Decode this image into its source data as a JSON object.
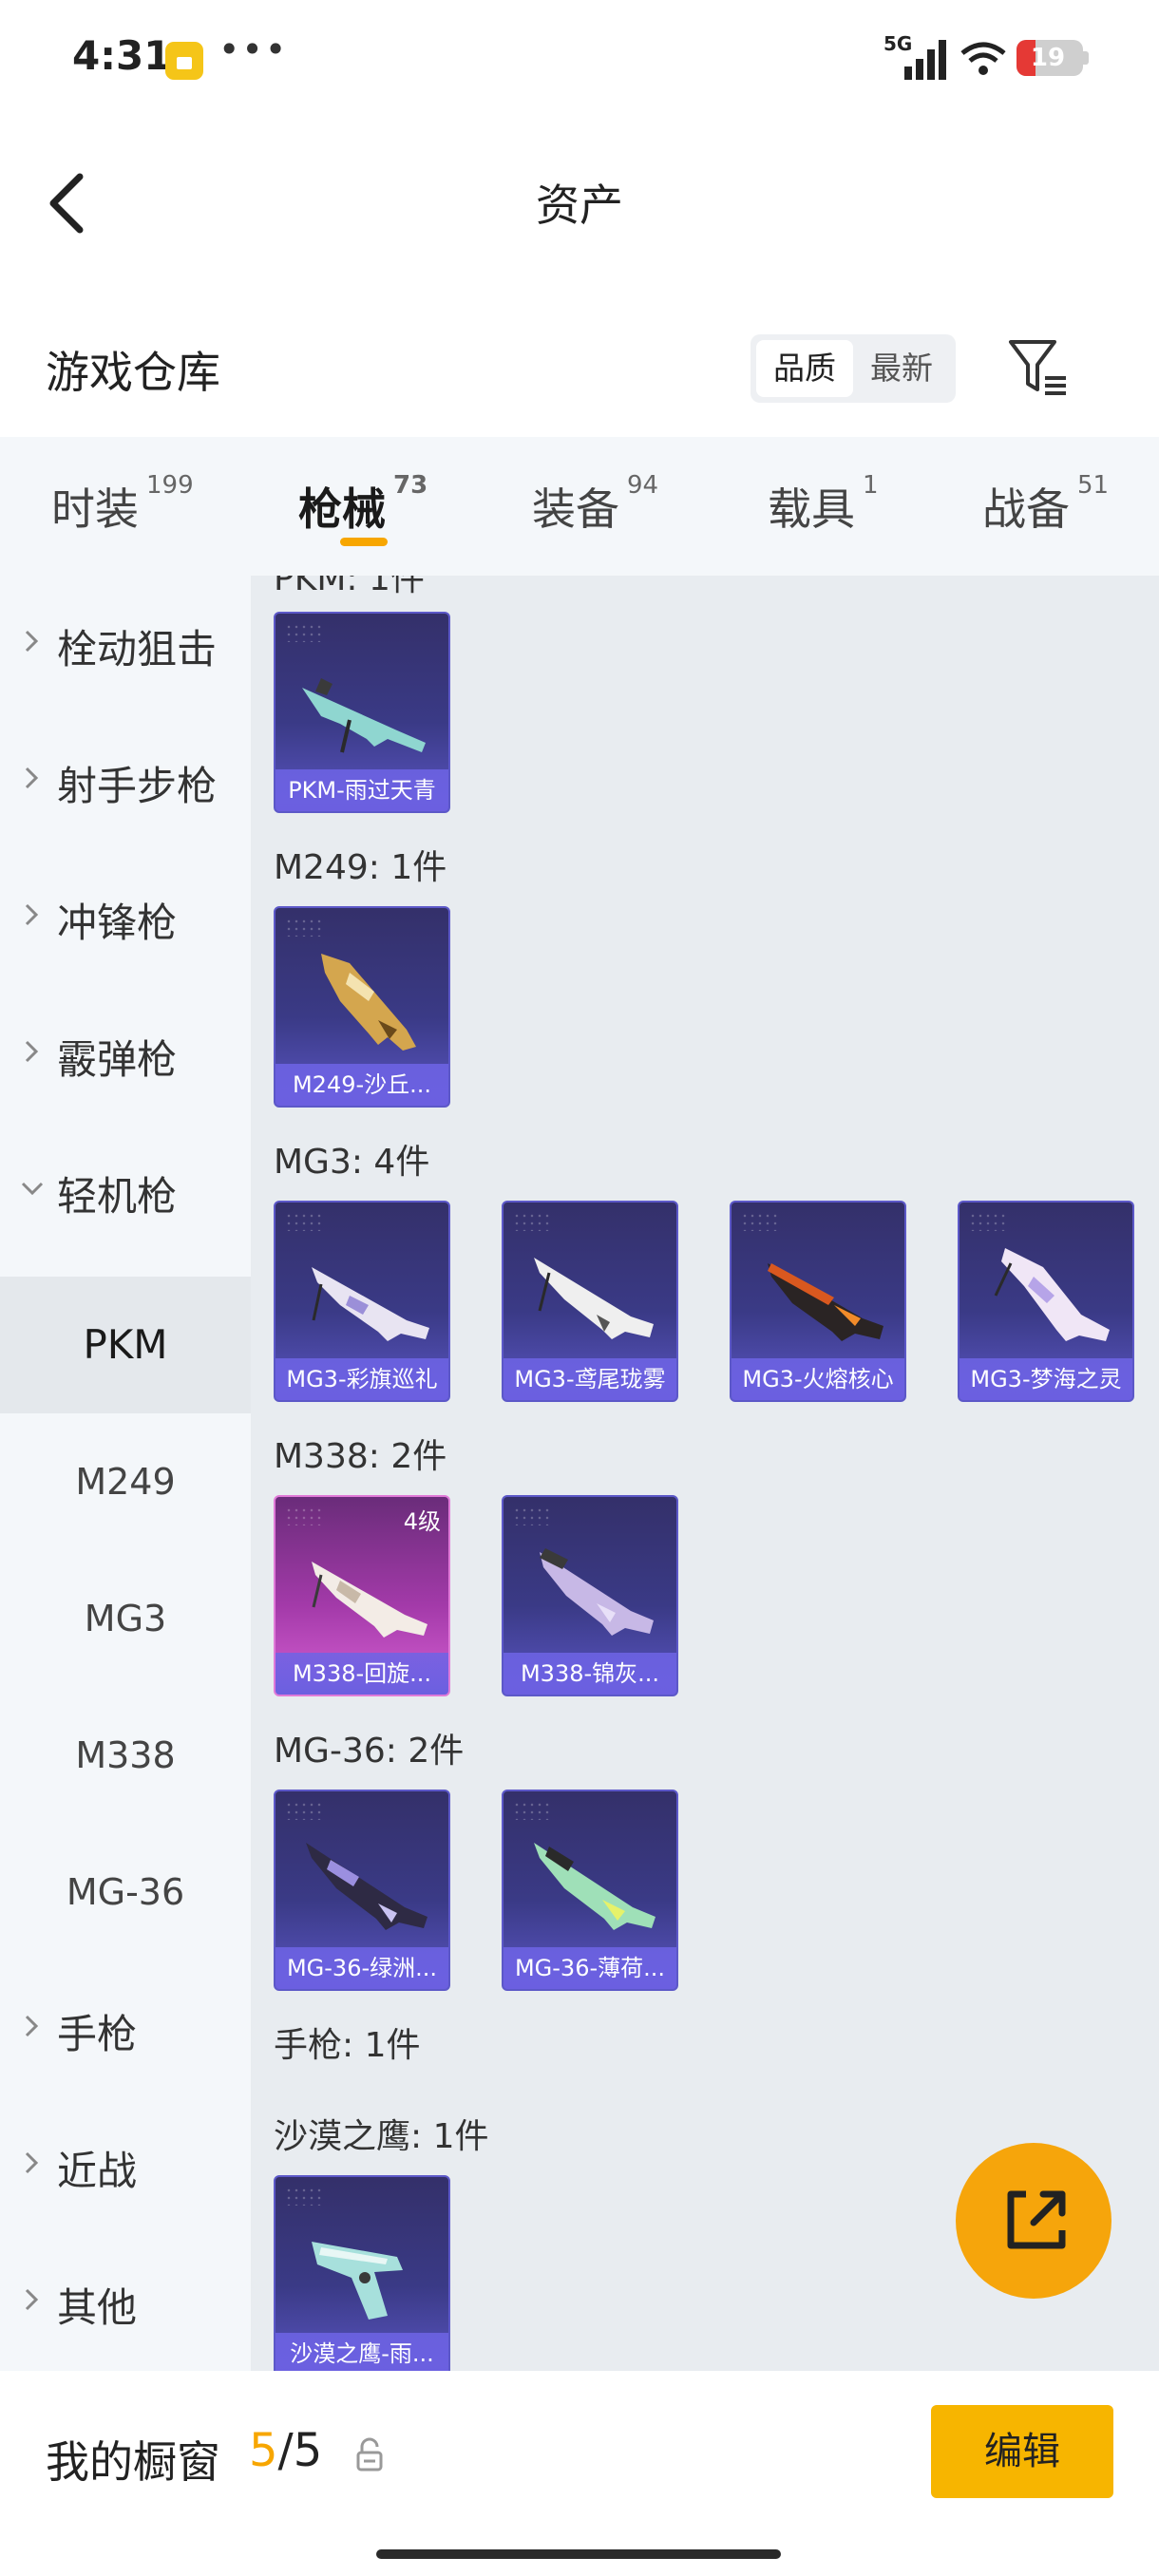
{
  "status_bar": {
    "time": "4:31",
    "network": "5G",
    "battery": "19"
  },
  "header": {
    "title": "资产"
  },
  "warehouse": {
    "title": "游戏仓库",
    "sort_options": [
      {
        "label": "品质",
        "active": true
      },
      {
        "label": "最新",
        "active": false
      }
    ]
  },
  "tabs": [
    {
      "label": "时装",
      "count": "199",
      "active": false
    },
    {
      "label": "枪械",
      "count": "73",
      "active": true
    },
    {
      "label": "装备",
      "count": "94",
      "active": false
    },
    {
      "label": "载具",
      "count": "1",
      "active": false
    },
    {
      "label": "战备",
      "count": "51",
      "active": false
    }
  ],
  "sidebar": {
    "categories": [
      {
        "label": "栓动狙击",
        "expanded": false
      },
      {
        "label": "射手步枪",
        "expanded": false
      },
      {
        "label": "冲锋枪",
        "expanded": false
      },
      {
        "label": "霰弹枪",
        "expanded": false
      },
      {
        "label": "轻机枪",
        "expanded": true
      }
    ],
    "subitems": [
      {
        "label": "PKM",
        "active": true
      },
      {
        "label": "M249",
        "active": false
      },
      {
        "label": "MG3",
        "active": false
      },
      {
        "label": "M338",
        "active": false
      },
      {
        "label": "MG-36",
        "active": false
      }
    ],
    "more_categories": [
      {
        "label": "手枪"
      },
      {
        "label": "近战"
      },
      {
        "label": "其他"
      }
    ]
  },
  "content": {
    "groups": [
      {
        "title": "PKM: 1件",
        "items": [
          {
            "name": "PKM-雨过天青",
            "rarity": "purple",
            "icon": "lmg-teal-icon"
          }
        ]
      },
      {
        "title": "M249: 1件",
        "items": [
          {
            "name": "M249-沙丘...",
            "rarity": "purple",
            "icon": "lmg-gold-icon"
          }
        ]
      },
      {
        "title": "MG3: 4件",
        "items": [
          {
            "name": "MG3-彩旗巡礼",
            "rarity": "purple",
            "icon": "lmg-white-icon"
          },
          {
            "name": "MG3-鸢尾珑雾",
            "rarity": "purple",
            "icon": "lmg-white-icon"
          },
          {
            "name": "MG3-火熔核心",
            "rarity": "purple",
            "icon": "lmg-dark-icon"
          },
          {
            "name": "MG3-梦海之灵",
            "rarity": "purple",
            "icon": "lmg-pastel-icon"
          }
        ]
      },
      {
        "title": "M338: 2件",
        "items": [
          {
            "name": "M338-回旋...",
            "rarity": "pink",
            "level": "4级",
            "icon": "lmg-white-icon"
          },
          {
            "name": "M338-锦灰...",
            "rarity": "purple",
            "icon": "lmg-lilac-icon"
          }
        ]
      },
      {
        "title": "MG-36: 2件",
        "items": [
          {
            "name": "MG-36-绿洲...",
            "rarity": "purple",
            "icon": "rifle-dark-icon"
          },
          {
            "name": "MG-36-薄荷...",
            "rarity": "purple",
            "icon": "rifle-mint-icon"
          }
        ]
      },
      {
        "title": "手枪: 1件",
        "items": []
      },
      {
        "title": "沙漠之鹰: 1件",
        "items": [
          {
            "name": "沙漠之鹰-雨...",
            "rarity": "purple",
            "icon": "pistol-teal-icon"
          }
        ]
      }
    ]
  },
  "showcase": {
    "label": "我的橱窗",
    "current": "5",
    "total": "5",
    "edit_label": "编辑"
  },
  "colors": {
    "accent": "#f7a600",
    "card_purple": "#3a3a86",
    "card_pink": "#a33aa9"
  }
}
